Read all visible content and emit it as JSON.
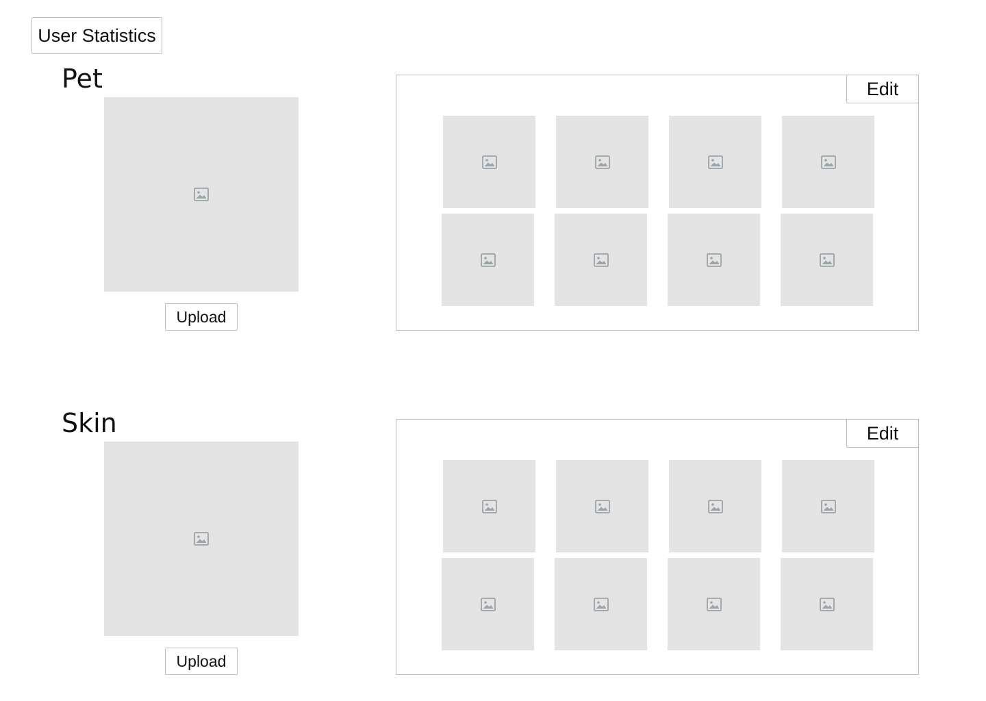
{
  "header": {
    "stats_button_label": "User Statistics"
  },
  "icon": "image-placeholder-icon",
  "colors": {
    "placeholder_bg": "#e4e4e4",
    "border": "#bdbdbd",
    "icon": "#9aa3a8"
  },
  "sections": [
    {
      "title": "Pet",
      "upload_label": "Upload",
      "edit_label": "Edit",
      "gallery_count": 8
    },
    {
      "title": "Skin",
      "upload_label": "Upload",
      "edit_label": "Edit",
      "gallery_count": 8
    }
  ]
}
